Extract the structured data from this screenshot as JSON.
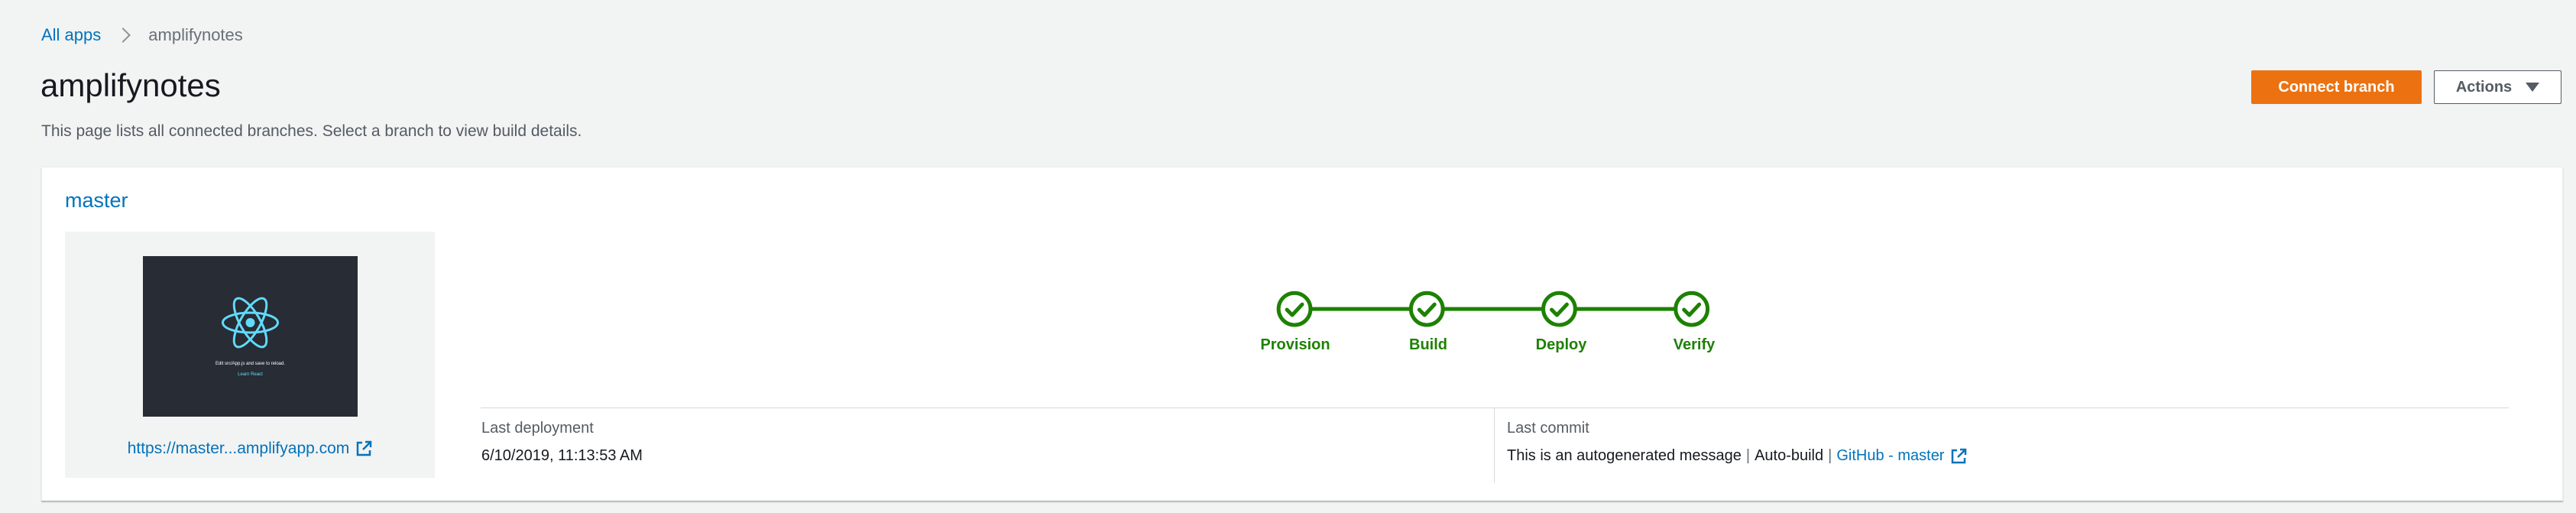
{
  "breadcrumb": {
    "root": "All apps",
    "current": "amplifynotes"
  },
  "header": {
    "title": "amplifynotes",
    "description": "This page lists all connected branches. Select a branch to view build details.",
    "connect_branch_label": "Connect branch",
    "actions_label": "Actions"
  },
  "branch": {
    "name": "master",
    "preview": {
      "thumbnail_text": "Edit src/App.js and save to reload.",
      "thumbnail_link": "Learn React",
      "url": "https://master...amplifyapp.com"
    },
    "pipeline": {
      "stages": [
        {
          "label": "Provision",
          "status": "complete"
        },
        {
          "label": "Build",
          "status": "complete"
        },
        {
          "label": "Deploy",
          "status": "complete"
        },
        {
          "label": "Verify",
          "status": "complete"
        }
      ]
    },
    "last_deployment": {
      "label": "Last deployment",
      "value": "6/10/2019, 11:13:53 AM"
    },
    "last_commit": {
      "label": "Last commit",
      "message": "This is an autogenerated message",
      "separator": "|",
      "build_type": "Auto-build",
      "repo_link": "GitHub - master"
    }
  },
  "colors": {
    "accent": "#ec7211",
    "link": "#0073bb",
    "success": "#1d8102",
    "react": "#61dafb"
  },
  "icons": [
    "chevron-right-icon",
    "caret-down-icon",
    "react-logo-icon",
    "external-link-icon",
    "check-circle-icon"
  ]
}
